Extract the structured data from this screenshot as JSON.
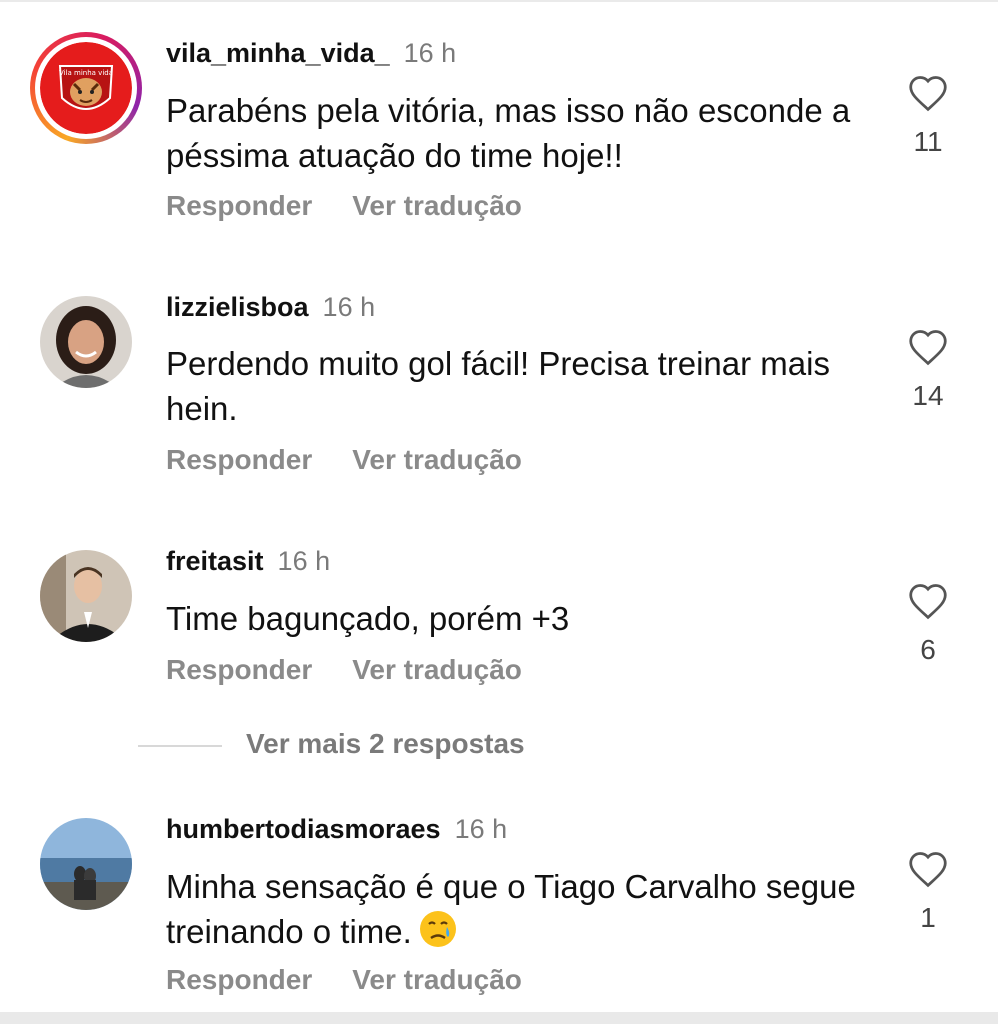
{
  "comments": [
    {
      "username": "vila_minha_vida_",
      "time": "16 h",
      "text": "Parabéns pela vitória, mas isso não esconde a péssima atuação do time hoje!!",
      "likes": "11",
      "reply": "Responder",
      "translate": "Ver tradução",
      "avatar_logo_text": "Vila minha vida"
    },
    {
      "username": "lizzielisboa",
      "time": "16 h",
      "text": "Perdendo muito gol fácil! Precisa treinar mais hein.",
      "likes": "14",
      "reply": "Responder",
      "translate": "Ver tradução"
    },
    {
      "username": "freitasit",
      "time": "16 h",
      "text": "Time bagunçado, porém +3",
      "likes": "6",
      "reply": "Responder",
      "translate": "Ver tradução"
    },
    {
      "username": "humbertodiasmoraes",
      "time": "16 h",
      "text": "Minha sensação é que o Tiago Carvalho segue treinando o time.",
      "likes": "1",
      "reply": "Responder",
      "translate": "Ver tradução",
      "emoji": "crying-face-emoji"
    }
  ],
  "more_replies": "Ver mais 2 respostas",
  "icons": {
    "like": "heart-outline-icon"
  },
  "colors": {
    "muted": "#8a8a8a",
    "text": "#111111",
    "ring_start": "#f9a825",
    "ring_end": "#d81b60"
  }
}
